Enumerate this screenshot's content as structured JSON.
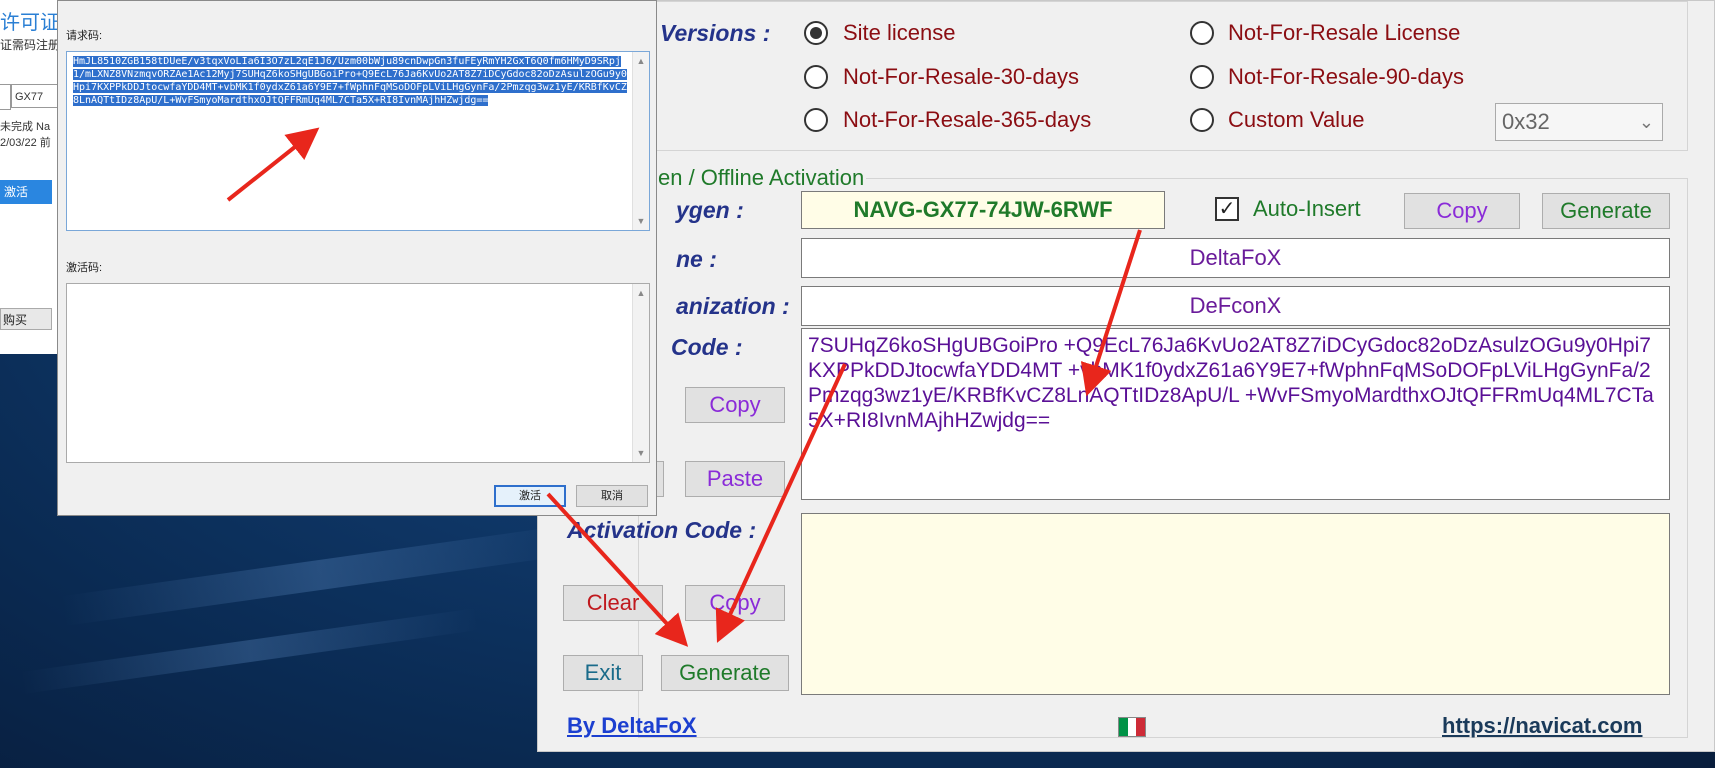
{
  "bg_window": {
    "title": "许可证",
    "subtitle": "证需码注册",
    "input_value": "GX77",
    "line1": "未完成 Na",
    "line2": "2/03/22 前",
    "btn_activate": "激活",
    "btn_buy": "购买"
  },
  "dialog": {
    "request_label": "请求码:",
    "request_text": "HmJL8510ZGB158tDUeE/v3tqxVoLIa6I3O7zL2qE1J6/Uzm00bWju89cnDwpGn3fuFEyRmYH2GxT6Q0fm6HMyD9SRpj1/mLXNZ8VNzmqvORZAe1Ac12Myj7SUHqZ6koSHgUBGoiPro+Q9EcL76Ja6KvUo2AT8Z7iDCyGdoc82oDzAsulzOGu9y0Hpi7KXPPkDDJtocwfaYDD4MT+vbMK1f0ydxZ61a6Y9E7+fWphnFqMSoDOFpLViLHgGynFa/2Pmzqg3wz1yE/KRBfKvCZ8LnAQTtIDz8ApU/L+WvFSmyoMardthxOJtQFFRmUq4ML7CTa5X+RI8IvnMAjhHZwjdg==",
    "activation_label": "激活码:",
    "ok_label": "激活",
    "cancel_label": "取消"
  },
  "keygen": {
    "versions_label": "Versions :",
    "radios": [
      {
        "label": "Site license",
        "checked": true
      },
      {
        "label": "Not-For-Resale License",
        "checked": false
      },
      {
        "label": "Not-For-Resale-30-days",
        "checked": false
      },
      {
        "label": "Not-For-Resale-90-days",
        "checked": false
      },
      {
        "label": "Not-For-Resale-365-days",
        "checked": false
      },
      {
        "label": "Custom Value",
        "checked": false
      }
    ],
    "custom_value": "0x32",
    "group_title": "en / Offline Activation",
    "keygen_label": "ygen :",
    "serial": "NAVG-GX77-74JW-6RWF",
    "auto_insert_label": "Auto-Insert",
    "auto_insert_checked": true,
    "copy_label": "Copy",
    "generate_label": "Generate",
    "name_label": "ne :",
    "name_value": "DeltaFoX",
    "org_label": "anization :",
    "org_value": "DeFconX",
    "request_code_label": "Code :",
    "request_code_value": "7SUHqZ6koSHgUBGoiPro +Q9EcL76Ja6KvUo2AT8Z7iDCyGdoc82oDzAsulzOGu9y0Hpi7KXPPkDDJtocwfaYDD4MT +vbMK1f0ydxZ61a6Y9E7+fWphnFqMSoDOFpLViLHgGynFa/2Pmzqg3wz1yE/KRBfKvCZ8LnAQTtIDz8ApU/L +WvFSmyoMardthxOJtQFFRmUq4ML7CTa5X+RI8IvnMAjhHZwjdg==",
    "req_copy_label": "Copy",
    "req_paste_label": "Paste",
    "activation_code_label": "Activation Code :",
    "clear_label": "Clear",
    "act_copy_label": "Copy",
    "exit_label": "Exit",
    "act_generate_label": "Generate",
    "by_label": "By DeltaFoX",
    "url_label": "https://navicat.com"
  },
  "colors": {
    "red_label": "#8b0d12",
    "green_text": "#1f7a2a",
    "purple_text": "#6a1b9a",
    "navy_label": "#24338a",
    "selection_blue": "#2e6fcc",
    "arrow_red": "#e8261c"
  }
}
